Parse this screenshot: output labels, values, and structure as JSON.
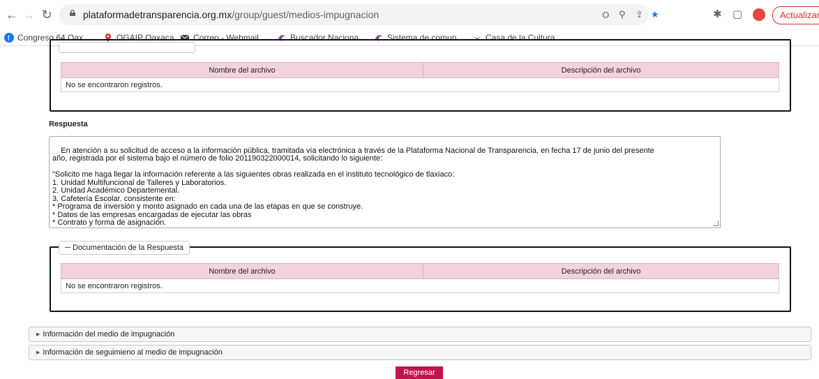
{
  "browser": {
    "url_host": "plataformadetransparencia.org.mx",
    "url_path": "/group/guest/medios-impugnacion",
    "update_label": "Actualizar",
    "bookmarks": [
      {
        "label": "Congreso 64 Oax...",
        "icon": "facebook-icon",
        "color": "#1877f2"
      },
      {
        "label": "OGAIP Oaxaca",
        "icon": "location-pin-icon",
        "color": "#d93025"
      },
      {
        "label": "Correo - Webmail...",
        "icon": "mail-icon",
        "color": "#3c4043"
      },
      {
        "label": "Buscador Naciona...",
        "icon": "pnt-logo-icon",
        "color": "#8e44ad"
      },
      {
        "label": "Sistema de comun...",
        "icon": "pnt-logo-icon",
        "color": "#8e44ad"
      },
      {
        "label": "Casa de la Cultura...",
        "icon": "bird-icon",
        "color": "#5c6bc0"
      }
    ]
  },
  "top_table": {
    "headers": [
      "Nombre del archivo",
      "Descripción del archivo"
    ],
    "empty_message": "No se encontraron registros."
  },
  "respuesta": {
    "title": "Respuesta",
    "text": "En atención a su solicitud de acceso a la información pública, tramitada vía electrónica a través de la Plataforma Nacional de Transparencia, en fecha 17 de junio del presente\naño, registrada por el sistema bajo el número de folio 201190322000014, solicitando lo siguiente:\n\n\"Solicito me haga llegar la información referente a las siguientes obras realizada en el instituto tecnológico de tlaxiaco:\n1. Unidad Multifuncional de Talleres y Laboratorios.\n2. Unidad Académico Departemental.\n3. Cafetería Escolar. consistente en:\n* Programa de inversión y monto asignado en cada una de las etapas en que se construye.\n* Datos de las empresas encargadas de ejecutar las obras\n* Contrato y forma de asignación."
  },
  "documentacion": {
    "legend": "Documentación de la Respuesta",
    "headers": [
      "Nombre del archivo",
      "Descripción del archivo"
    ],
    "empty_message": "No se encontraron registros."
  },
  "accordions": [
    {
      "label": "Información del medio de impugnación"
    },
    {
      "label": "Información de seguimieno al medio de impugnación"
    }
  ],
  "regresar_label": "Regresar",
  "colors": {
    "accent": "#c0144f",
    "table_header": "#f2d2dc"
  }
}
